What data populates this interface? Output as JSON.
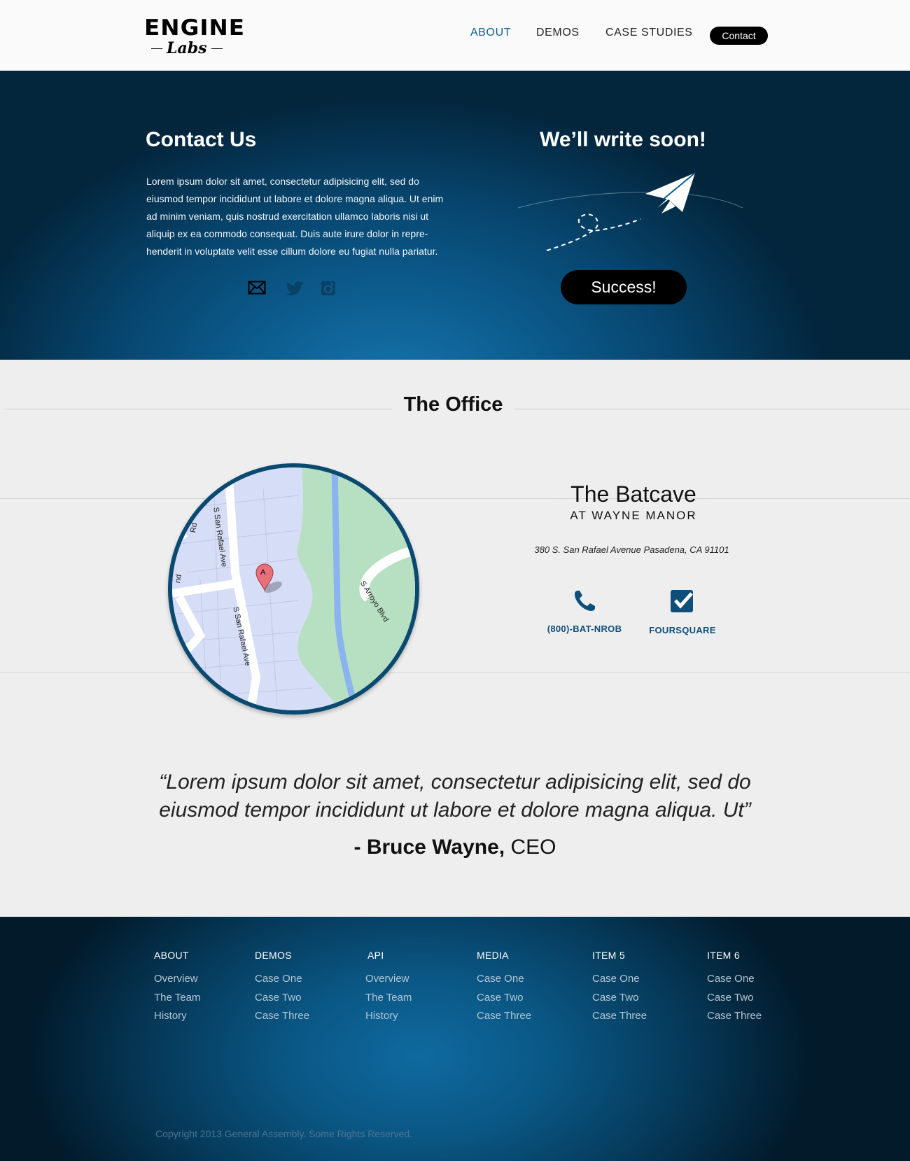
{
  "header": {
    "logo_top": "ENGINE",
    "logo_bottom": "Labs",
    "nav": [
      {
        "label": "ABOUT"
      },
      {
        "label": "DEMOS"
      },
      {
        "label": "CASE STUDIES"
      }
    ],
    "contact_label": "Contact"
  },
  "hero": {
    "title": "Contact Us",
    "body": "Lorem ipsum dolor sit amet, consectetur adipisicing elit, sed do eiusmod tempor incididunt ut labore et dolore magna aliqua. Ut enim ad minim veniam, quis nostrud exercitation ullamco laboris nisi ut aliquip ex ea commodo consequat. Duis aute irure dolor in repre-henderit in voluptate velit esse cillum dolore eu fugiat nulla pariatur.",
    "social_icons": [
      "mail-icon",
      "twitter-icon",
      "instagram-icon"
    ],
    "right_title": "We’ll write soon!",
    "success_label": "Success!"
  },
  "office": {
    "title": "The Office",
    "map": {
      "streets": [
        "S San Rafael Ave",
        "S San Rafael Ave",
        "S Arroyo Blvd",
        "Rd",
        "nd"
      ],
      "marker": "A"
    },
    "name": "The Batcave",
    "subtitle": "AT WAYNE MANOR",
    "address": "380 S. San Rafael Avenue Pasadena, CA 91101",
    "phone_label": "(800)-BAT-NROB",
    "foursquare_label": "FOURSQUARE"
  },
  "quote": {
    "text": "“Lorem ipsum dolor sit amet, consectetur adipisicing elit, sed do eiusmod tempor incididunt ut labore et dolore magna aliqua. Ut”",
    "author": "- Bruce Wayne,",
    "role": "CEO"
  },
  "footer": {
    "columns": [
      {
        "heading": "ABOUT",
        "links": [
          "Overview",
          "The Team",
          "History"
        ]
      },
      {
        "heading": "DEMOS",
        "links": [
          "Case One",
          "Case Two",
          "Case Three"
        ]
      },
      {
        "heading": "API",
        "links": [
          "Overview",
          "The Team",
          "History"
        ]
      },
      {
        "heading": "MEDIA",
        "links": [
          "Case One",
          "Case Two",
          "Case Three"
        ]
      },
      {
        "heading": "ITEM 5",
        "links": [
          "Case One",
          "Case Two",
          "Case Three"
        ]
      },
      {
        "heading": "ITEM 6",
        "links": [
          "Case One",
          "Case Two",
          "Case Three"
        ]
      }
    ],
    "copyright": "Copyright 2013 General Assembly. Some Rights Reserved."
  },
  "colors": {
    "accent": "#0d5f8f",
    "hero_blue": "#0c5c8e",
    "button_black": "#000000"
  }
}
